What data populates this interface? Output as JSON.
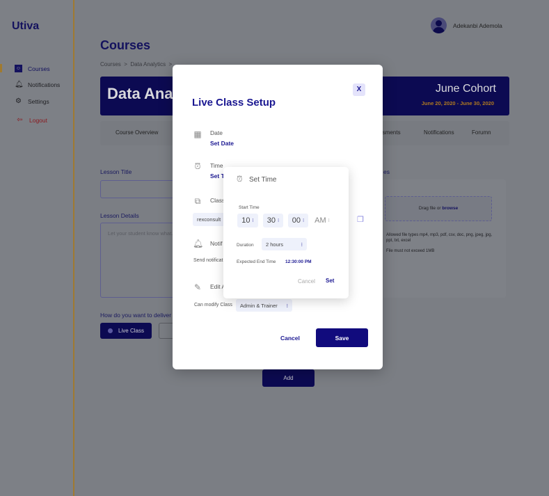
{
  "sidebar": {
    "logo": "Utiva",
    "items": [
      {
        "label": "Courses",
        "icon": "monitor-user-icon",
        "active": true
      },
      {
        "label": "Notifications",
        "icon": "bell-icon"
      },
      {
        "label": "Settings",
        "icon": "gear-icon"
      },
      {
        "label": "Logout",
        "icon": "logout-icon"
      }
    ]
  },
  "header": {
    "user_name": "Adekanbi Ademola",
    "avatar_icon": "user-avatar-icon"
  },
  "main": {
    "title": "Courses",
    "breadcrumb": [
      "Courses",
      ">",
      "Data Analytics",
      ">"
    ],
    "banner": {
      "title": "Data Analytics",
      "cohort": "June Cohort",
      "dates": "June 20, 2020 - June 30, 2020"
    },
    "tabs": [
      "Course Overview",
      "Assessments",
      "Notifications",
      "Forumn"
    ],
    "lesson_title_label": "Lesson Title",
    "lesson_details_label": "Lesson Details",
    "lesson_details_placeholder": "Let your student know what...",
    "deliver_question": "How do you want to deliver le...",
    "live_class_label": "Live Class",
    "add_label": "Add",
    "resources_label": "es",
    "drag_text": "Drag file or ",
    "browse": "browse",
    "allowed_types": "Allowed file types mp4, mp3, pdf, csv, doc, png, jpeg, jpg, ppt, txt, excel",
    "size_note": "File must not exceed 1MB"
  },
  "modal": {
    "title": "Live Class Setup",
    "close": "X",
    "date_label": "Date",
    "date_value": "Set Date",
    "time_label": "Time",
    "time_value": "Set Time",
    "class_label": "Class",
    "class_value": "rexconsult",
    "notif_label": "Notif",
    "notif_sub": "Send notificat",
    "edit_label": "Edit A",
    "modify_label": "Can modify Class",
    "modify_value": "Admin & Trainer",
    "cancel": "Cancel",
    "save": "Save"
  },
  "set_time": {
    "title": "Set Time",
    "start_label": "Start Time",
    "hour": "10",
    "minute": "30",
    "second": "00",
    "ampm": "AM",
    "duration_label": "Duration",
    "duration": "2 hours",
    "end_label": "Expected End Time",
    "end_value": "12:30:00 PM",
    "cancel": "Cancel",
    "set": "Set"
  },
  "colors": {
    "brand": "#1a1791",
    "accent": "#e0a030",
    "logout": "#d0202a"
  }
}
